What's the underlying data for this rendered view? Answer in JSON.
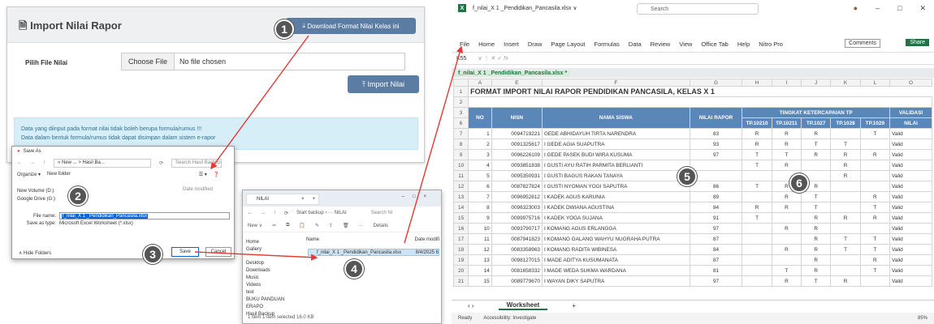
{
  "import_panel": {
    "title": "Import Nilai Rapor",
    "download_button": "Download Format Nilai Kelas ini",
    "file_label": "Pilih File Nilai",
    "choose_file": "Choose File",
    "no_file": "No file chosen",
    "import_button": "Import Nilai",
    "alert_line1": "Data yang diinput pada format nilai tidak boleh berupa formula/rumus !!!",
    "alert_line2": "Data dalam bentuk formula/rumus tidak dapat disimpan dalam sistem e-rapor"
  },
  "save_dialog": {
    "title": "Save As",
    "path": "« New ... > Hasil Ba...",
    "search": "Search Hasil Backup",
    "organize": "Organize ▾",
    "new_folder": "New folder",
    "nav_items": [
      "New Volume (D:)",
      "Google Drive (G:)"
    ],
    "col_date": "Date modified",
    "file_name_label": "File name:",
    "file_name_value": "f_nilai_X 1 _Pendidikan_Pancasila.xlsx",
    "save_type_label": "Save as type:",
    "save_type_value": "Microsoft Excel Worksheet (*.xlsx)",
    "hide_folders": "∧ Hide Folders",
    "save": "Save",
    "cancel": "Cancel"
  },
  "explorer": {
    "tab": "NILAI",
    "breadcrumb": "Start backup › ···  NILAI",
    "search": "Search NI",
    "new": "New ∨",
    "details": "Details",
    "tree": [
      "Home",
      "Gallery",
      "Desktop",
      "Downloads",
      "Music",
      "Videos",
      "test",
      "BUKU PANDUAN ERAPO",
      "Hasil Backup"
    ],
    "col_name": "Name",
    "col_date": "Date modifi",
    "file": "f_nilai_X 1 _Pendidikan_Pancasila.xlsx",
    "file_date": "8/4/2025 6",
    "status": "1 item   1 item selected  16.0 KB"
  },
  "excel": {
    "file_name": "f_nilai_X 1 _Pendidikan_Pancasila.xlsx ∨",
    "search": "Search",
    "menu": [
      "File",
      "Home",
      "Insert",
      "Draw",
      "Page Layout",
      "Formulas",
      "Data",
      "Review",
      "View",
      "Office Tab",
      "Help",
      "Nitro Pro"
    ],
    "comments": "Comments",
    "share": "Share",
    "cell_ref": "K55",
    "workbook_tab": "f_nilai_X 1 _Pendidikan_Pancasila.xlsx *",
    "col_letters": [
      "A",
      "E",
      "F",
      "G",
      "H",
      "I",
      "J",
      "K",
      "L",
      "O"
    ],
    "sheet_title": "FORMAT IMPORT NILAI RAPOR PENDIDIKAN PANCASILA, KELAS  X 1",
    "headers": {
      "no": "NO",
      "nisn": "NISN",
      "nama": "NAMA SISWA",
      "nilai": "NILAI RAPOR",
      "tingkat": "TINGKAT KETERCAPAIAN TP",
      "validasi": "VALIDASI",
      "nilai2": "NILAI",
      "tp": [
        "TP.10210",
        "TP.10211",
        "TP.1027",
        "TP.1028",
        "TP.1029"
      ]
    },
    "rows": [
      [
        "1",
        "0094719221",
        "GEDE ABHIDAYUH TIRTA NARENDRA",
        "83",
        "R",
        "R",
        "R",
        "",
        "T",
        "Valid"
      ],
      [
        "2",
        "0091325617",
        "I GEDE AGIA SUAPUTRA",
        "93",
        "R",
        "R",
        "T",
        "T",
        "",
        "Valid"
      ],
      [
        "3",
        "0096226109",
        "I GEDE PASEK BUDI WIRA KUSUMA",
        "97",
        "T",
        "T",
        "R",
        "R",
        "R",
        "Valid"
      ],
      [
        "4",
        "0093851838",
        "I GUSTI AYU RATIH PARMITA BERLIANTI",
        "",
        "T",
        "R",
        "",
        "R",
        "",
        "Valid"
      ],
      [
        "5",
        "0095350931",
        "I GUSTI BAGUS RAKAN TANAYA",
        "",
        "",
        "",
        "",
        "R",
        "",
        "Valid"
      ],
      [
        "6",
        "0087827824",
        "I GUSTI NYOMAN YOGI SAPUTRA",
        "86",
        "T",
        "R",
        "R",
        "",
        "",
        "Valid"
      ],
      [
        "7",
        "0096952812",
        "I KADEK AGUS KARUNIA",
        "89",
        "",
        "R",
        "T",
        "",
        "R",
        "Valid"
      ],
      [
        "8",
        "0096323003",
        "I KADEK DWIANA AGUSTINA",
        "84",
        "R",
        "R",
        "T",
        "",
        "T",
        "Valid"
      ],
      [
        "9",
        "0099975716",
        "I KADEK YOGA SUJANA",
        "91",
        "T",
        "",
        "R",
        "R",
        "R",
        "Valid"
      ],
      [
        "10",
        "0093790717",
        "I KOMANG AGUS ERLANGGA",
        "97",
        "",
        "R",
        "R",
        "",
        "",
        "Valid"
      ],
      [
        "11",
        "0087941823",
        "I KOMANG GALANG WAHYU NUGRAHA PUTRA",
        "87",
        "",
        "",
        "R",
        "T",
        "T",
        "Valid"
      ],
      [
        "12",
        "0083358963",
        "I KOMANG RADITA WIBINESA",
        "84",
        "",
        "R",
        "R",
        "T",
        "T",
        "Valid"
      ],
      [
        "13",
        "0098127015",
        "I MADE ADITYA KUSUMANATA",
        "87",
        "",
        "",
        "R",
        "",
        "R",
        "Valid"
      ],
      [
        "14",
        "0081658332",
        "I MADE WEDA SUKMA WARDANA",
        "81",
        "",
        "T",
        "R",
        "",
        "T",
        "Valid"
      ],
      [
        "15",
        "0089779670",
        "I WAYAN DIKY SAPUTRA",
        "97",
        "",
        "R",
        "T",
        "R",
        "",
        "Valid"
      ]
    ],
    "row_numbers": [
      "1",
      "2",
      "3",
      "6",
      "7",
      "8",
      "9",
      "10",
      "11",
      "12",
      "13",
      "14",
      "15",
      "16",
      "17",
      "18",
      "19",
      "20",
      "21"
    ],
    "sheet_tab": "Worksheet",
    "status_ready": "Ready",
    "accessibility": "Accessibility: Investigate",
    "zoom": "85%"
  },
  "steps": [
    "1",
    "2",
    "3",
    "4",
    "5",
    "6"
  ],
  "colors": {
    "header_blue": "#5b86b8",
    "excel_green": "#217346",
    "arrow_red": "#e53935"
  }
}
